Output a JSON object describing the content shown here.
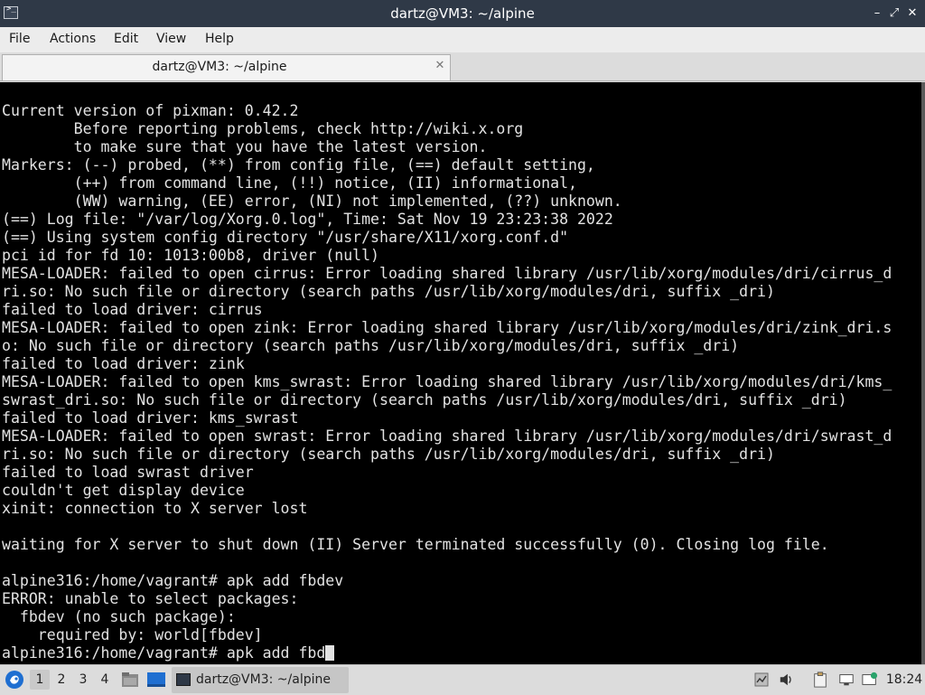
{
  "window": {
    "title": "dartz@VM3: ~/alpine",
    "app_icon_glyph": ">_",
    "minimize_glyph": "–",
    "maximize_glyph": "⤢",
    "close_glyph": "✕"
  },
  "menubar": {
    "items": [
      {
        "label": "File"
      },
      {
        "label": "Actions"
      },
      {
        "label": "Edit"
      },
      {
        "label": "View"
      },
      {
        "label": "Help"
      }
    ]
  },
  "tab": {
    "label": "dartz@VM3: ~/alpine",
    "close_glyph": "✕"
  },
  "terminal": {
    "lines": [
      "Current version of pixman: 0.42.2",
      "        Before reporting problems, check http://wiki.x.org",
      "        to make sure that you have the latest version.",
      "Markers: (--) probed, (**) from config file, (==) default setting,",
      "        (++) from command line, (!!) notice, (II) informational,",
      "        (WW) warning, (EE) error, (NI) not implemented, (??) unknown.",
      "(==) Log file: \"/var/log/Xorg.0.log\", Time: Sat Nov 19 23:23:38 2022",
      "(==) Using system config directory \"/usr/share/X11/xorg.conf.d\"",
      "pci id for fd 10: 1013:00b8, driver (null)",
      "MESA-LOADER: failed to open cirrus: Error loading shared library /usr/lib/xorg/modules/dri/cirrus_d",
      "ri.so: No such file or directory (search paths /usr/lib/xorg/modules/dri, suffix _dri)",
      "failed to load driver: cirrus",
      "MESA-LOADER: failed to open zink: Error loading shared library /usr/lib/xorg/modules/dri/zink_dri.s",
      "o: No such file or directory (search paths /usr/lib/xorg/modules/dri, suffix _dri)",
      "failed to load driver: zink",
      "MESA-LOADER: failed to open kms_swrast: Error loading shared library /usr/lib/xorg/modules/dri/kms_",
      "swrast_dri.so: No such file or directory (search paths /usr/lib/xorg/modules/dri, suffix _dri)",
      "failed to load driver: kms_swrast",
      "MESA-LOADER: failed to open swrast: Error loading shared library /usr/lib/xorg/modules/dri/swrast_d",
      "ri.so: No such file or directory (search paths /usr/lib/xorg/modules/dri, suffix _dri)",
      "failed to load swrast driver",
      "couldn't get display device",
      "xinit: connection to X server lost",
      "",
      "waiting for X server to shut down (II) Server terminated successfully (0). Closing log file.",
      "",
      "alpine316:/home/vagrant# apk add fbdev",
      "ERROR: unable to select packages:",
      "  fbdev (no such package):",
      "    required by: world[fbdev]"
    ],
    "prompt_line": "alpine316:/home/vagrant# apk add fbd"
  },
  "taskbar": {
    "workspaces": [
      "1",
      "2",
      "3",
      "4"
    ],
    "active_workspace": "1",
    "task_label": "dartz@VM3: ~/alpine",
    "clock": "18:24",
    "icons": [
      "start-menu-icon",
      "file-manager-icon",
      "show-desktop-icon",
      "terminal-icon",
      "system-monitor-icon",
      "volume-icon",
      "clipboard-icon",
      "network-icon",
      "update-notifier-icon"
    ]
  },
  "colors": {
    "titlebar_bg": "#2f3947",
    "terminal_bg": "#000000",
    "terminal_fg": "#e2e2e2",
    "taskbar_bg": "#dcdcdc",
    "start_icon_blue": "#1f6fd1"
  }
}
